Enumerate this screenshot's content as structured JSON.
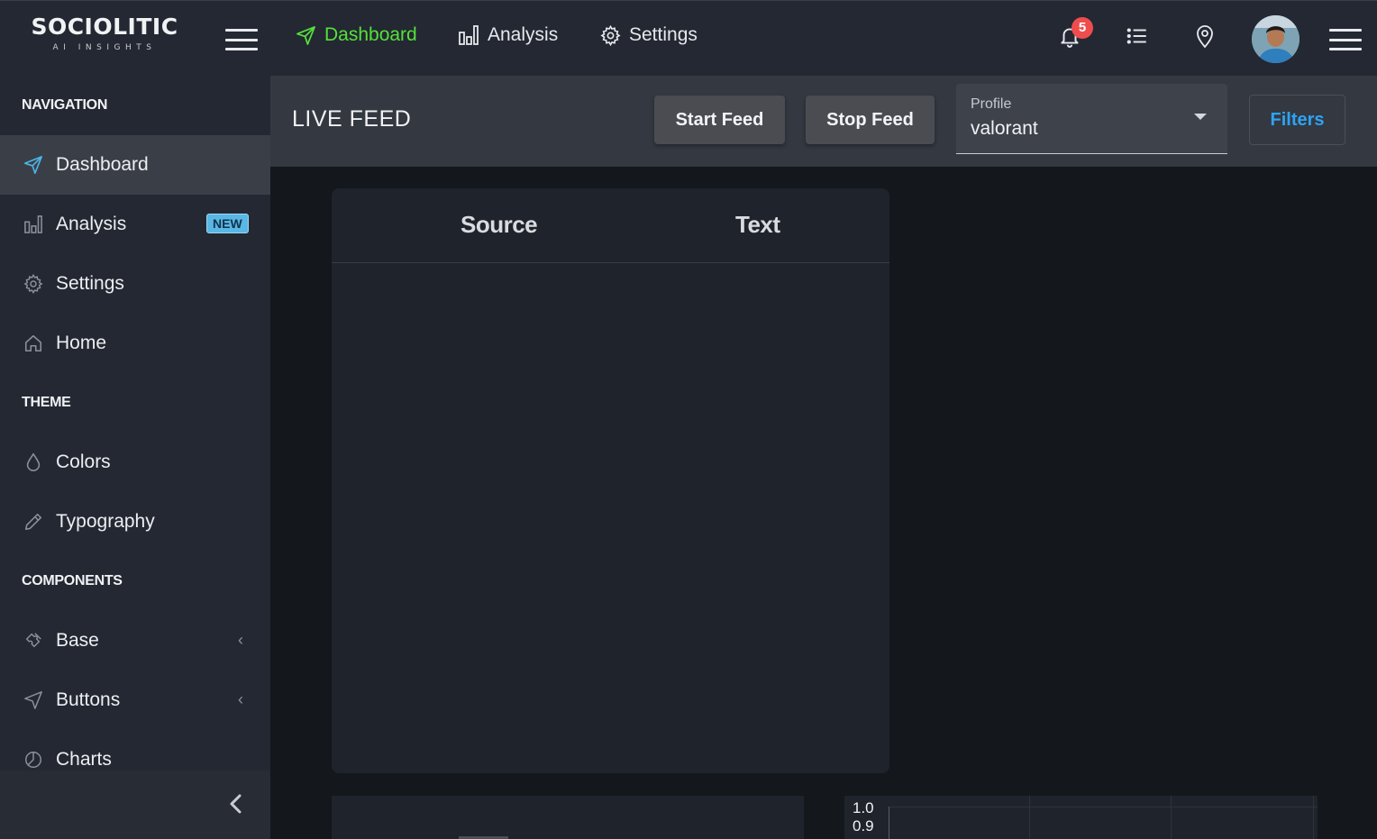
{
  "brand": {
    "name": "SOCIOLITIC",
    "tagline": "AI INSIGHTS"
  },
  "topnav": {
    "items": [
      {
        "label": "Dashboard",
        "icon": "send-icon",
        "active": true
      },
      {
        "label": "Analysis",
        "icon": "bar-chart-icon"
      },
      {
        "label": "Settings",
        "icon": "gear-icon"
      }
    ],
    "notifications_count": "5",
    "accent_color": "#56e03a"
  },
  "sidebar": {
    "sections": {
      "navigation": "NAVIGATION",
      "theme": "THEME",
      "components": "COMPONENTS"
    },
    "items": [
      {
        "label": "Dashboard",
        "icon": "send-icon",
        "active": true
      },
      {
        "label": "Analysis",
        "icon": "bar-chart-icon",
        "badge": "NEW"
      },
      {
        "label": "Settings",
        "icon": "gear-icon"
      },
      {
        "label": "Home",
        "icon": "home-icon"
      },
      {
        "label": "Colors",
        "icon": "drop-icon"
      },
      {
        "label": "Typography",
        "icon": "pencil-icon"
      },
      {
        "label": "Base",
        "icon": "puzzle-icon",
        "expandable": true
      },
      {
        "label": "Buttons",
        "icon": "cursor-icon",
        "expandable": true
      },
      {
        "label": "Charts",
        "icon": "pie-chart-icon"
      }
    ]
  },
  "subheader": {
    "title": "LIVE FEED",
    "start_label": "Start Feed",
    "stop_label": "Stop Feed",
    "profile_label": "Profile",
    "profile_value": "valorant",
    "filters_label": "Filters",
    "filters_color": "#2ea3f2"
  },
  "feed_table": {
    "columns": [
      "Source",
      "Text"
    ],
    "rows": []
  },
  "chart_preview": {
    "y_ticks": [
      "1.0",
      "0.9"
    ]
  }
}
